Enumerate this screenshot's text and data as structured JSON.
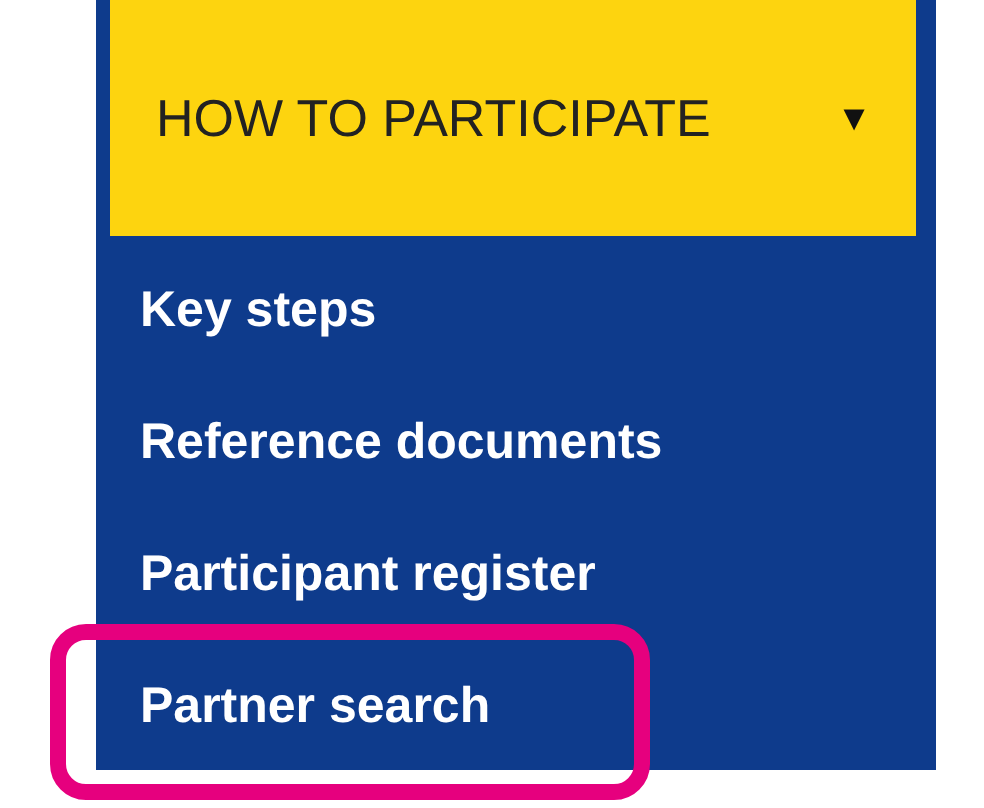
{
  "menu": {
    "label": "HOW TO PARTICIPATE",
    "caret": "▼",
    "expanded": true
  },
  "items": [
    {
      "label": "Key steps",
      "highlighted": false
    },
    {
      "label": "Reference documents",
      "highlighted": false
    },
    {
      "label": "Participant register",
      "highlighted": false
    },
    {
      "label": "Partner search",
      "highlighted": true
    }
  ]
}
